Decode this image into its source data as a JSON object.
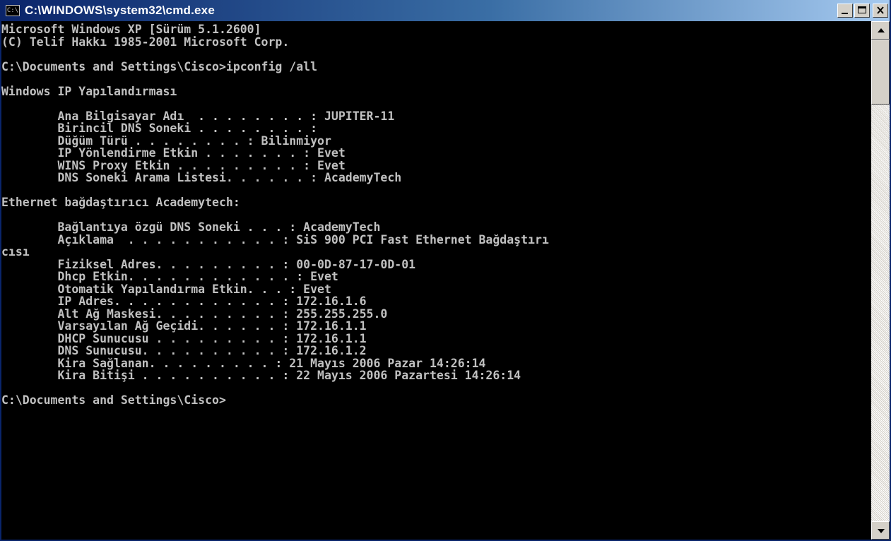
{
  "window": {
    "title": "C:\\WINDOWS\\system32\\cmd.exe",
    "icon_label": "C:\\"
  },
  "console": {
    "lines": [
      "Microsoft Windows XP [Sürüm 5.1.2600]",
      "(C) Telif Hakkı 1985-2001 Microsoft Corp.",
      "",
      "C:\\Documents and Settings\\Cisco>ipconfig /all",
      "",
      "Windows IP Yapılandırması",
      "",
      "        Ana Bilgisayar Adı  . . . . . . . . : JUPITER-11",
      "        Birincil DNS Soneki . . . . . . . . :",
      "        Düğüm Türü . . . . . . . . : Bilinmiyor",
      "        IP Yönlendirme Etkin . . . . . . . : Evet",
      "        WINS Proxy Etkin . . . . . . . . . : Evet",
      "        DNS Soneki Arama Listesi. . . . . . : AcademyTech",
      "",
      "Ethernet bağdaştırıcı Academytech:",
      "",
      "        Bağlantıya özgü DNS Soneki . . . : AcademyTech",
      "        Açıklama  . . . . . . . . . . . : SiS 900 PCI Fast Ethernet Bağdaştırı",
      "cısı",
      "        Fiziksel Adres. . . . . . . . . : 00-0D-87-17-0D-01",
      "        Dhcp Etkin. . . . . . . . . . . . : Evet",
      "        Otomatik Yapılandırma Etkin. . . : Evet",
      "        IP Adres. . . . . . . . . . . . : 172.16.1.6",
      "        Alt Ağ Maskesi. . . . . . . . . : 255.255.255.0",
      "        Varsayılan Ağ Geçidi. . . . . . : 172.16.1.1",
      "        DHCP Sunucusu . . . . . . . . . : 172.16.1.1",
      "        DNS Sunucusu. . . . . . . . . . : 172.16.1.2",
      "        Kira Sağlanan. . . . . . . . . : 21 Mayıs 2006 Pazar 14:26:14",
      "        Kira Bitişi . . . . . . . . . . : 22 Mayıs 2006 Pazartesi 14:26:14",
      "",
      "C:\\Documents and Settings\\Cisco>"
    ]
  },
  "colors": {
    "console_background": "#000000",
    "console_text": "#c0c0c0",
    "titlebar_start": "#0a246a",
    "titlebar_end": "#a6caf0"
  }
}
